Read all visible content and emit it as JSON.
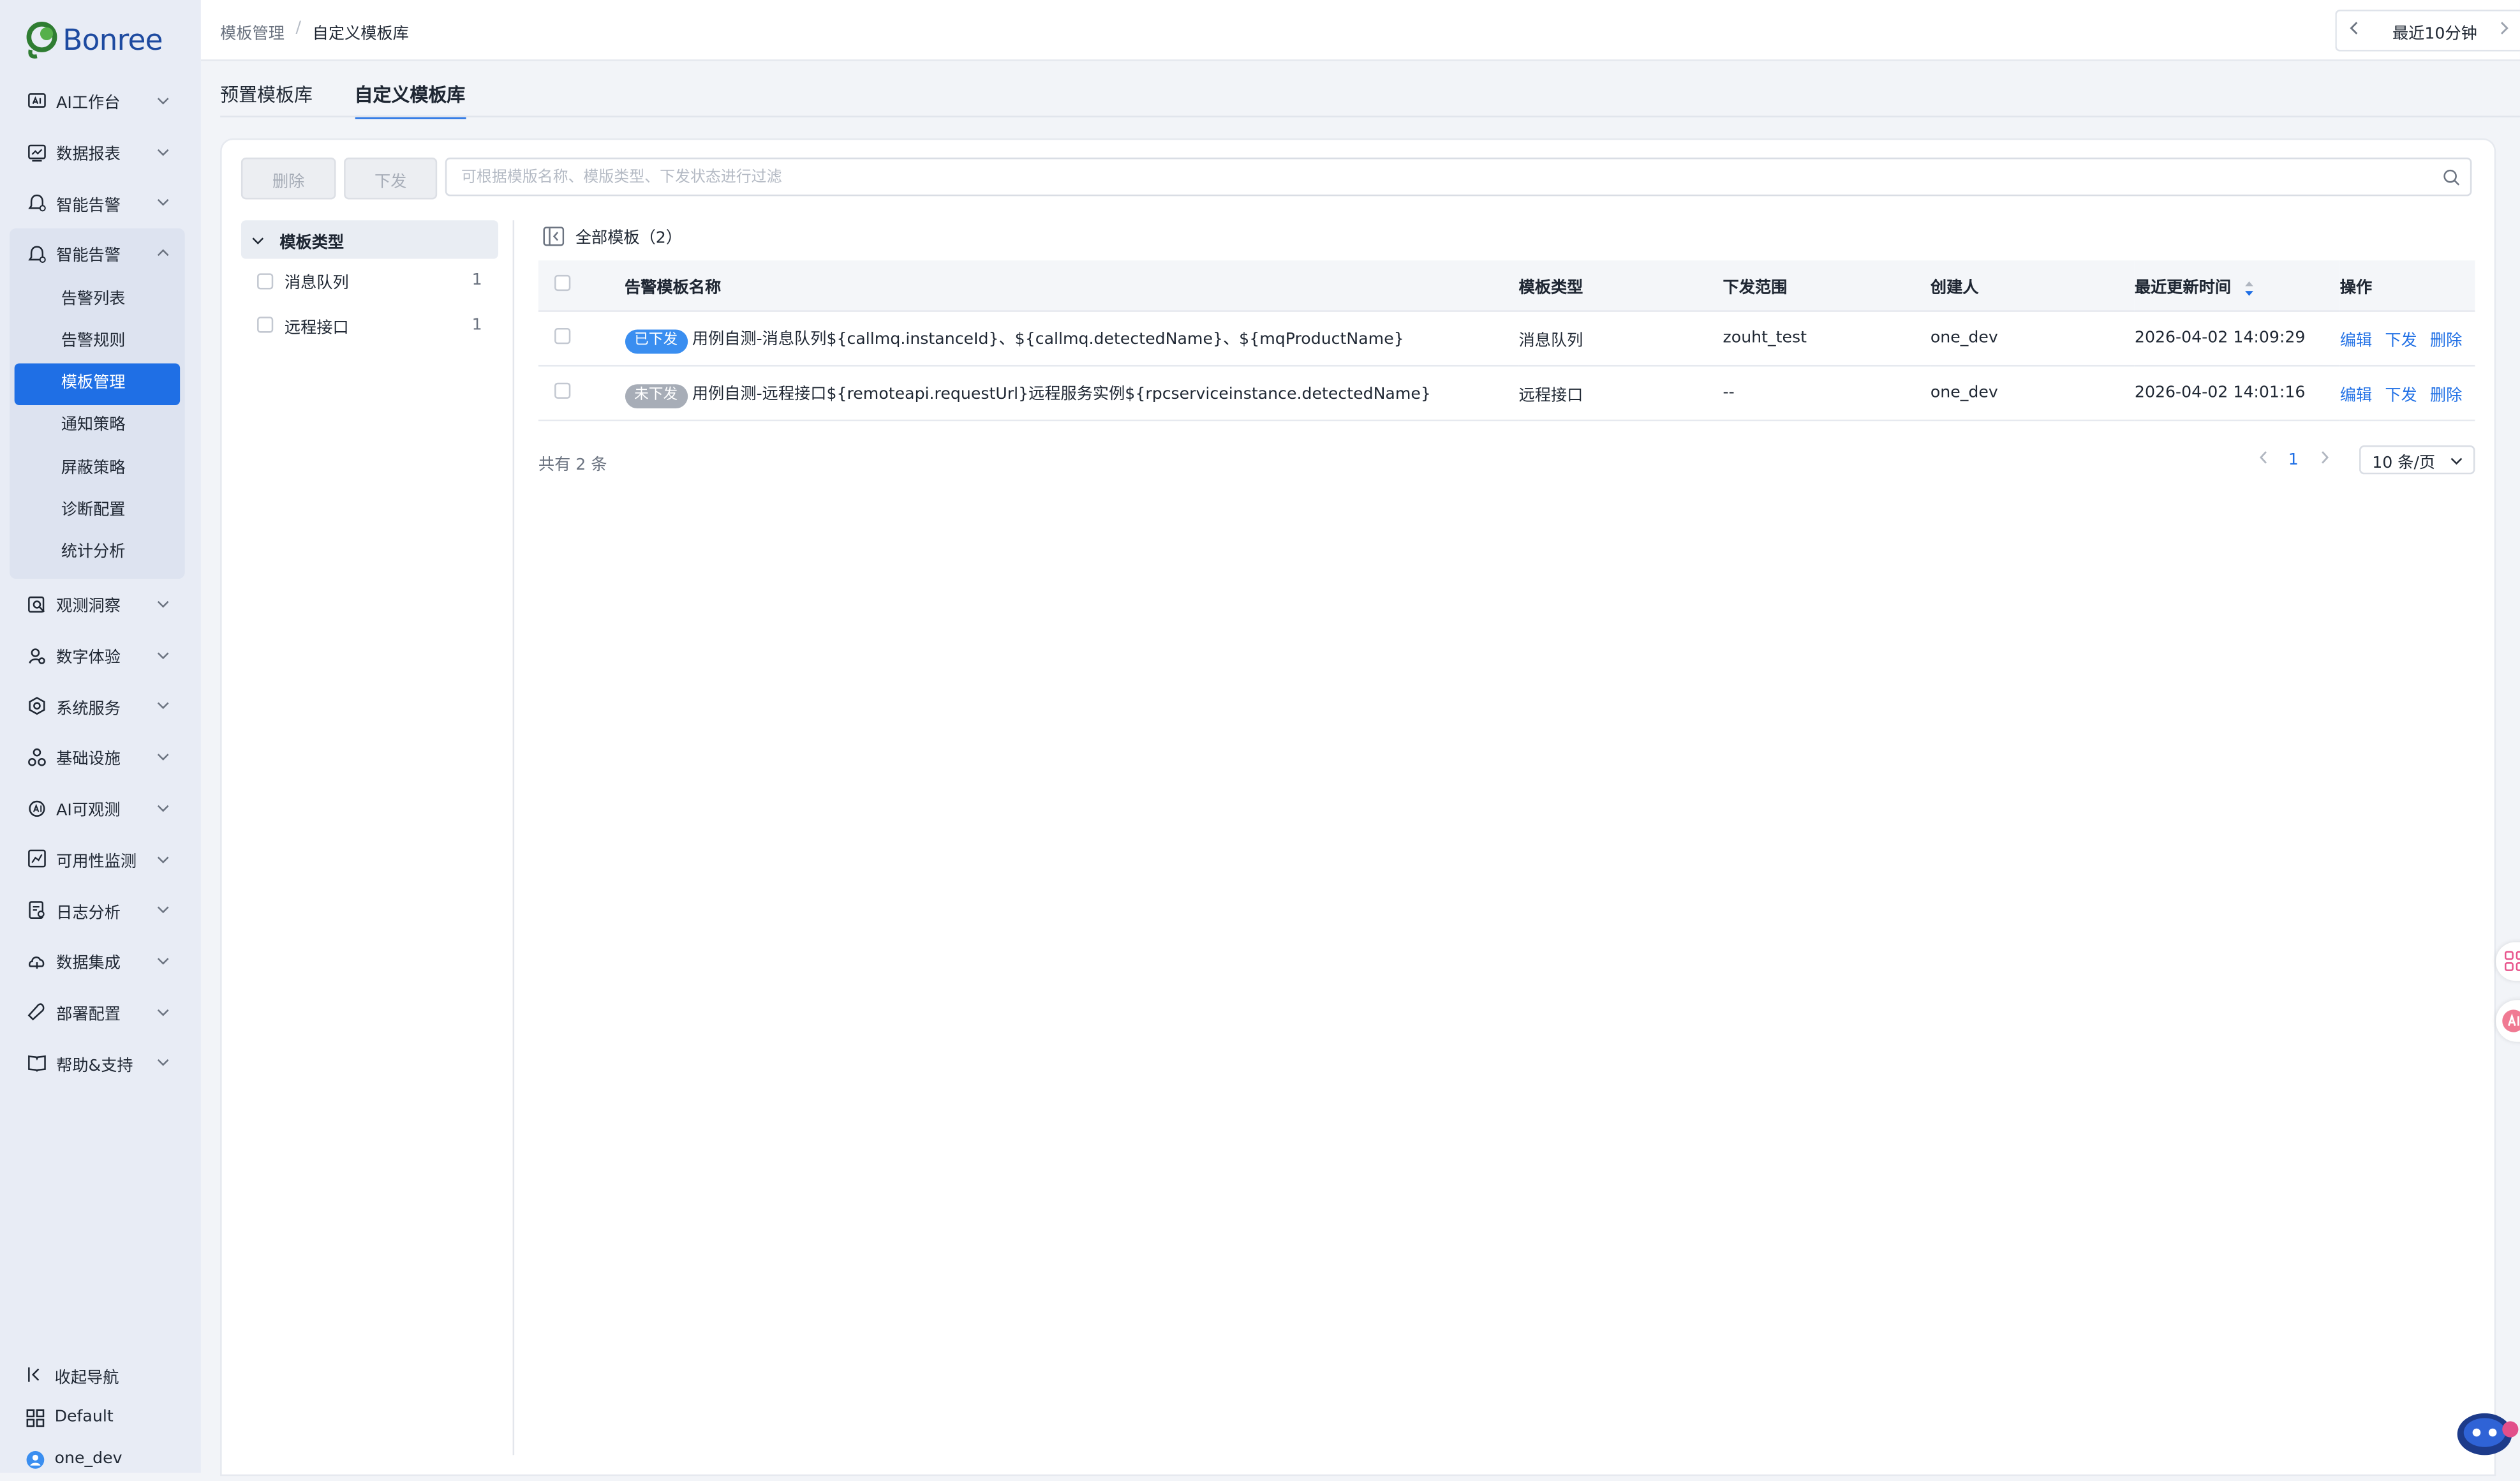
{
  "logo": {
    "text": "Bonree"
  },
  "sidebar": {
    "items_top": [
      {
        "label": "AI工作台",
        "icon": "ai-workbench-icon"
      },
      {
        "label": "数据报表",
        "icon": "report-icon"
      },
      {
        "label": "智能告警",
        "icon": "alert-icon"
      }
    ],
    "expanded": {
      "label": "智能告警",
      "icon": "alert-icon",
      "children": [
        "告警列表",
        "告警规则",
        "模板管理",
        "通知策略",
        "屏蔽策略",
        "诊断配置",
        "统计分析"
      ],
      "active": "模板管理"
    },
    "items_bottom": [
      {
        "label": "观测洞察",
        "icon": "insight-icon"
      },
      {
        "label": "数字体验",
        "icon": "digital-experience-icon"
      },
      {
        "label": "系统服务",
        "icon": "system-service-icon"
      },
      {
        "label": "基础设施",
        "icon": "infrastructure-icon"
      },
      {
        "label": "AI可观测",
        "icon": "ai-observe-icon"
      },
      {
        "label": "可用性监测",
        "icon": "availability-icon"
      },
      {
        "label": "日志分析",
        "icon": "log-icon"
      },
      {
        "label": "数据集成",
        "icon": "data-integration-icon"
      },
      {
        "label": "部署配置",
        "icon": "deploy-icon"
      },
      {
        "label": "帮助&支持",
        "icon": "help-icon"
      }
    ],
    "collapse_label": "收起导航",
    "workspace_label": "Default",
    "user_label": "one_dev"
  },
  "header": {
    "breadcrumb": [
      "模板管理",
      "自定义模板库"
    ],
    "time_range": "最近10分钟"
  },
  "tabs": [
    {
      "label": "预置模板库",
      "active": false
    },
    {
      "label": "自定义模板库",
      "active": true
    }
  ],
  "toolbar": {
    "delete_label": "删除",
    "dispatch_label": "下发",
    "search_placeholder": "可根据模版名称、模版类型、下发状态进行过滤"
  },
  "filter_tree": {
    "title": "模板类型",
    "options": [
      {
        "label": "消息队列",
        "count": "1"
      },
      {
        "label": "远程接口",
        "count": "1"
      }
    ]
  },
  "list": {
    "title": "全部模板（2）",
    "columns": [
      "告警模板名称",
      "模板类型",
      "下发范围",
      "创建人",
      "最近更新时间",
      "操作"
    ],
    "rows": [
      {
        "status": "已下发",
        "name": "用例自测-消息队列${callmq.instanceId}、${callmq.detectedName}、${mqProductName}",
        "type": "消息队列",
        "scope": "zouht_test",
        "creator": "one_dev",
        "updated": "2026-04-02 14:09:29",
        "actions": [
          "编辑",
          "下发",
          "删除"
        ]
      },
      {
        "status": "未下发",
        "name": "用例自测-远程接口${remoteapi.requestUrl}远程服务实例${rpcserviceinstance.detectedName}",
        "type": "远程接口",
        "scope": "--",
        "creator": "one_dev",
        "updated": "2026-04-02 14:01:16",
        "actions": [
          "编辑",
          "下发",
          "删除"
        ]
      }
    ],
    "total_text": "共有 2 条",
    "page": "1",
    "page_size": "10 条/页"
  },
  "colors": {
    "accent": "#1f6fe5",
    "sidebar_bg": "#e8ecf5",
    "tag_dispatched": "#3a8ef0",
    "tag_not_dispatched": "#a7adb7"
  }
}
